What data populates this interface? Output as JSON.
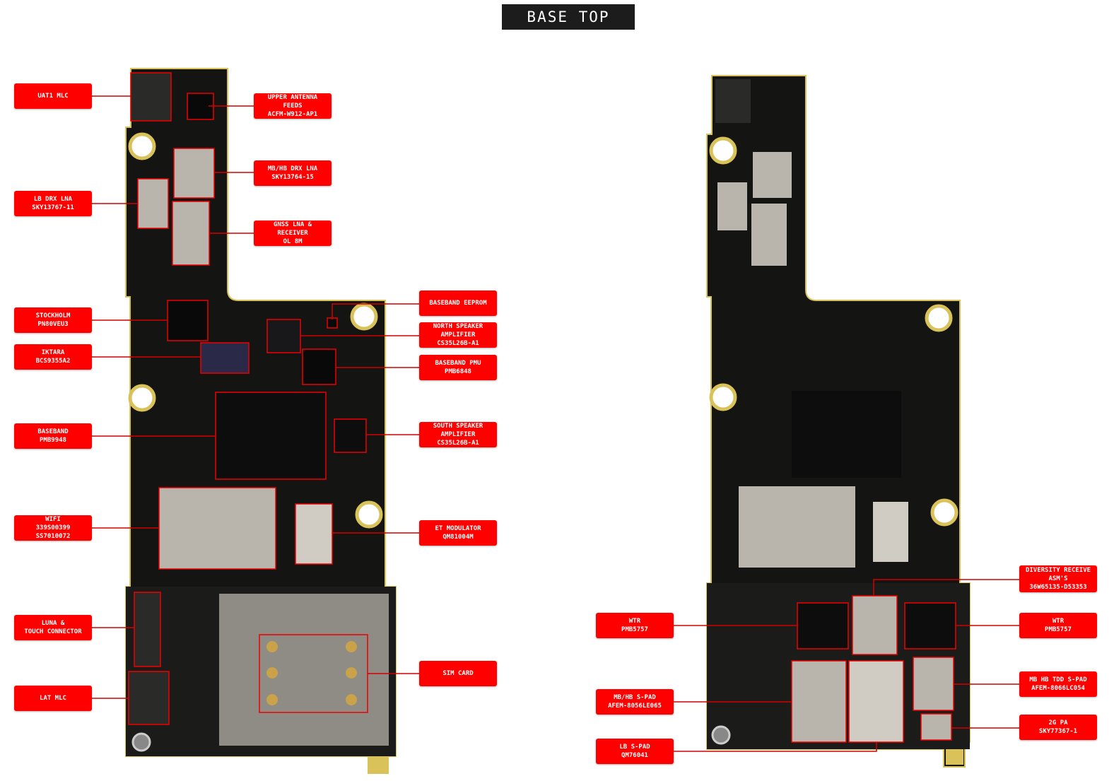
{
  "title": "BASE TOP",
  "colors": {
    "label_bg": "#ff0000",
    "label_text": "#ffffff",
    "board": "#141512",
    "shield": "#b9b5ad",
    "gold": "#d9c25a"
  },
  "left_board": {
    "labels": [
      {
        "id": "uat1-mlc",
        "text": "UAT1 MLC"
      },
      {
        "id": "upper-antenna-feeds",
        "text": "UPPER ANTENNA\nFEEDS\nACFM-W912-AP1"
      },
      {
        "id": "mb-hb-drx-lna",
        "text": "MB/HB DRX LNA\nSKY13764-15"
      },
      {
        "id": "lb-drx-lna",
        "text": "LB DRX LNA\nSKY13767-11"
      },
      {
        "id": "gnss-lna-receiver",
        "text": "GNSS LNA &\nRECEIVER\nOL 8M"
      },
      {
        "id": "stockholm",
        "text": "STOCKHOLM\nPN80VEU3"
      },
      {
        "id": "iktara",
        "text": "IKTARA\nBCS9355A2"
      },
      {
        "id": "baseband-eeprom",
        "text": "BASEBAND EEPROM"
      },
      {
        "id": "north-speaker-amplifier",
        "text": "NORTH SPEAKER\nAMPLIFIER\nCS35L26B-A1"
      },
      {
        "id": "baseband-pmu",
        "text": "BASEBAND PMU\nPMB6848"
      },
      {
        "id": "baseband",
        "text": "BASEBAND\nPMB9948"
      },
      {
        "id": "south-speaker-amplifier",
        "text": "SOUTH SPEAKER\nAMPLIFIER\nCS35L26B-A1"
      },
      {
        "id": "wifi",
        "text": "WIFI\n339S00399\nSS7010072"
      },
      {
        "id": "et-modulator",
        "text": "ET MODULATOR\nQM81004M"
      },
      {
        "id": "luna-touch-connector",
        "text": "LUNA &\nTOUCH CONNECTOR"
      },
      {
        "id": "sim-card",
        "text": "SIM CARD"
      },
      {
        "id": "lat-mlc",
        "text": "LAT MLC"
      }
    ]
  },
  "right_board": {
    "labels": [
      {
        "id": "diversity-receive-asms",
        "text": "DIVERSITY RECEIVE\nASM'S\n36W65135-D53353"
      },
      {
        "id": "wtr-left",
        "text": "WTR\nPMB5757"
      },
      {
        "id": "wtr-right",
        "text": "WTR\nPMB5757"
      },
      {
        "id": "mb-hb-s-pad",
        "text": "MB/HB S-PAD\nAFEM-8056LE065"
      },
      {
        "id": "mb-hb-tdd-s-pad",
        "text": "MB HB TDD S-PAD\nAFEM-8066LC054"
      },
      {
        "id": "2g-pa",
        "text": "2G PA\nSKY77367-1"
      },
      {
        "id": "lb-s-pad",
        "text": "LB S-PAD\nQM76041"
      }
    ]
  }
}
